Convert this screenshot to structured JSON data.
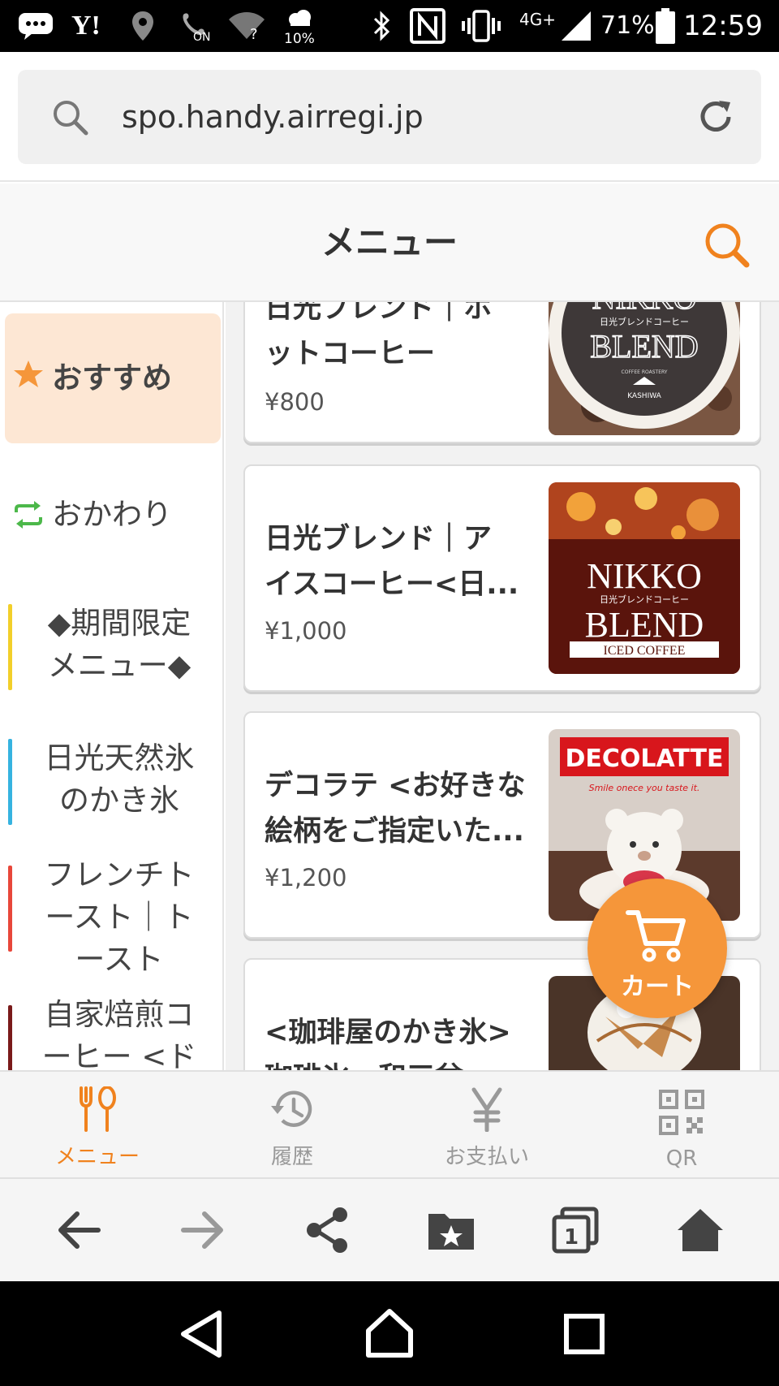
{
  "status_bar": {
    "network": "4G+",
    "battery": "71%",
    "time": "12:59",
    "weather_percent": "10%",
    "on_badge": "ON",
    "icons": [
      "message-icon",
      "yahoo-icon",
      "location-icon",
      "wifi-calling-icon",
      "wifi-icon",
      "weather-icon",
      "bluetooth-icon",
      "nfc-icon",
      "vibrate-icon",
      "signal-icon",
      "battery-icon"
    ]
  },
  "browser": {
    "url": "spo.handy.airregi.jp"
  },
  "header": {
    "title": "メニュー",
    "accent_color": "#f0821e"
  },
  "sidebar": {
    "items": [
      {
        "label": "おすすめ",
        "icon": "star-icon",
        "active": true
      },
      {
        "label": "おかわり",
        "icon": "refill-icon"
      },
      {
        "label_lines": [
          "◆期間限定",
          "メニュー◆"
        ],
        "bar_color": "#f2cf2a"
      },
      {
        "label_lines": [
          "日光天然氷",
          "のかき氷"
        ],
        "bar_color": "#36b3e0"
      },
      {
        "label_lines": [
          "フレンチト",
          "ースト｜ト",
          "ースト"
        ],
        "bar_color": "#e8473a"
      },
      {
        "label_lines": [
          "自家焙煎コ",
          "ーヒー <ド"
        ],
        "bar_color": "#7a1a1a"
      }
    ]
  },
  "products": [
    {
      "title_lines": [
        "日光ブレンド｜ホ",
        "ットコーヒー"
      ],
      "price": "¥800",
      "image": "NIKKO BLEND hot coffee"
    },
    {
      "title_lines": [
        "日光ブレンド｜ア",
        "イスコーヒー<日..."
      ],
      "price": "¥1,000",
      "image": "NIKKO BLEND iced coffee"
    },
    {
      "title_lines": [
        "デコラテ <お好きな",
        "絵柄をご指定いた..."
      ],
      "price": "¥1,200",
      "image": "DECOLATTE bear latte"
    },
    {
      "title_lines": [
        "<珈琲屋のかき氷>",
        "珈琲氷・和三盆"
      ],
      "price": "",
      "image": "shaved ice"
    }
  ],
  "images": {
    "nikko_hot": {
      "line1": "NIKKO",
      "line2": "BLEND",
      "small": "日光ブレンドコーヒー",
      "roaster": "COFFEE ROASTERY",
      "brand": "KASHIWA"
    },
    "nikko_iced": {
      "line1": "NIKKO",
      "small": "日光ブレンドコーヒー",
      "line2": "BLEND",
      "band": "ICED COFFEE"
    },
    "decolatte": {
      "logo": "DECOLATTE",
      "tagline": "Smile onece you taste it."
    }
  },
  "cart": {
    "label": "カート"
  },
  "app_nav": {
    "items": [
      {
        "label": "メニュー",
        "icon": "fork-spoon-icon",
        "active": true
      },
      {
        "label": "履歴",
        "icon": "history-icon"
      },
      {
        "label": "お支払い",
        "icon": "yen-icon"
      },
      {
        "label": "QR",
        "icon": "qr-icon"
      }
    ]
  },
  "toolbar": {
    "buttons": [
      "back-icon",
      "forward-icon",
      "share-icon",
      "bookmarks-icon",
      "tabs-icon",
      "home-icon"
    ],
    "tab_count": "1"
  },
  "android_nav": {
    "buttons": [
      "back-triangle-icon",
      "home-circle-icon",
      "recents-square-icon"
    ]
  }
}
